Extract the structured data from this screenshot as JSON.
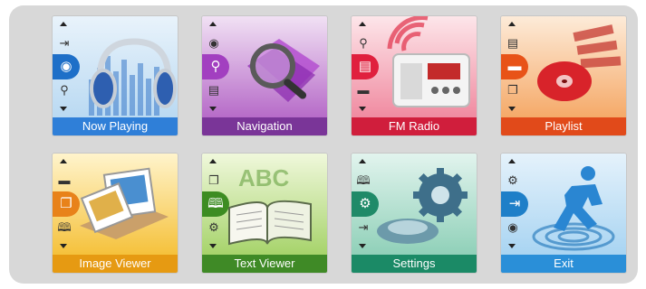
{
  "menu": {
    "tiles": [
      {
        "label": "Now Playing",
        "bar_color": "#2f7fd8",
        "bg_top": "#e9f3fb",
        "bg_bottom": "#b9d9f2",
        "accent": "#1e6fc8",
        "icons": [
          "import-icon",
          "disc-icon",
          "search-icon"
        ]
      },
      {
        "label": "Navigation",
        "bar_color": "#7a3598",
        "bg_top": "#f1e1f4",
        "bg_bottom": "#b66ac8",
        "accent": "#a23fc0",
        "icons": [
          "disc-icon",
          "search-icon",
          "radio-icon"
        ]
      },
      {
        "label": "FM Radio",
        "bar_color": "#d01e3c",
        "bg_top": "#fde6ea",
        "bg_bottom": "#f08aa0",
        "accent": "#e0203e",
        "icons": [
          "search-icon",
          "radio-icon",
          "folder-icon"
        ]
      },
      {
        "label": "Playlist",
        "bar_color": "#e14a1a",
        "bg_top": "#fdebd9",
        "bg_bottom": "#f5a968",
        "accent": "#e85318",
        "icons": [
          "radio-icon",
          "folder-icon",
          "gallery-icon"
        ]
      },
      {
        "label": "Image Viewer",
        "bar_color": "#e69a12",
        "bg_top": "#fff4cc",
        "bg_bottom": "#f5c13a",
        "accent": "#e8821a",
        "icons": [
          "folder-icon",
          "gallery-icon",
          "book-icon"
        ]
      },
      {
        "label": "Text Viewer",
        "bar_color": "#3f8a26",
        "bg_top": "#f0f8dc",
        "bg_bottom": "#a6d36a",
        "accent": "#3d8c22",
        "icons": [
          "gallery-icon",
          "book-icon",
          "gear-icon"
        ]
      },
      {
        "label": "Settings",
        "bar_color": "#1b8a66",
        "bg_top": "#e2f4ee",
        "bg_bottom": "#8fd0b8",
        "accent": "#1f8a68",
        "icons": [
          "book-icon",
          "gear-icon",
          "import-icon"
        ]
      },
      {
        "label": "Exit",
        "bar_color": "#2a8fd8",
        "bg_top": "#e5f2fb",
        "bg_bottom": "#a8d4f2",
        "accent": "#1e7fc8",
        "icons": [
          "gear-icon",
          "exit-icon",
          "disc-icon"
        ]
      }
    ]
  }
}
